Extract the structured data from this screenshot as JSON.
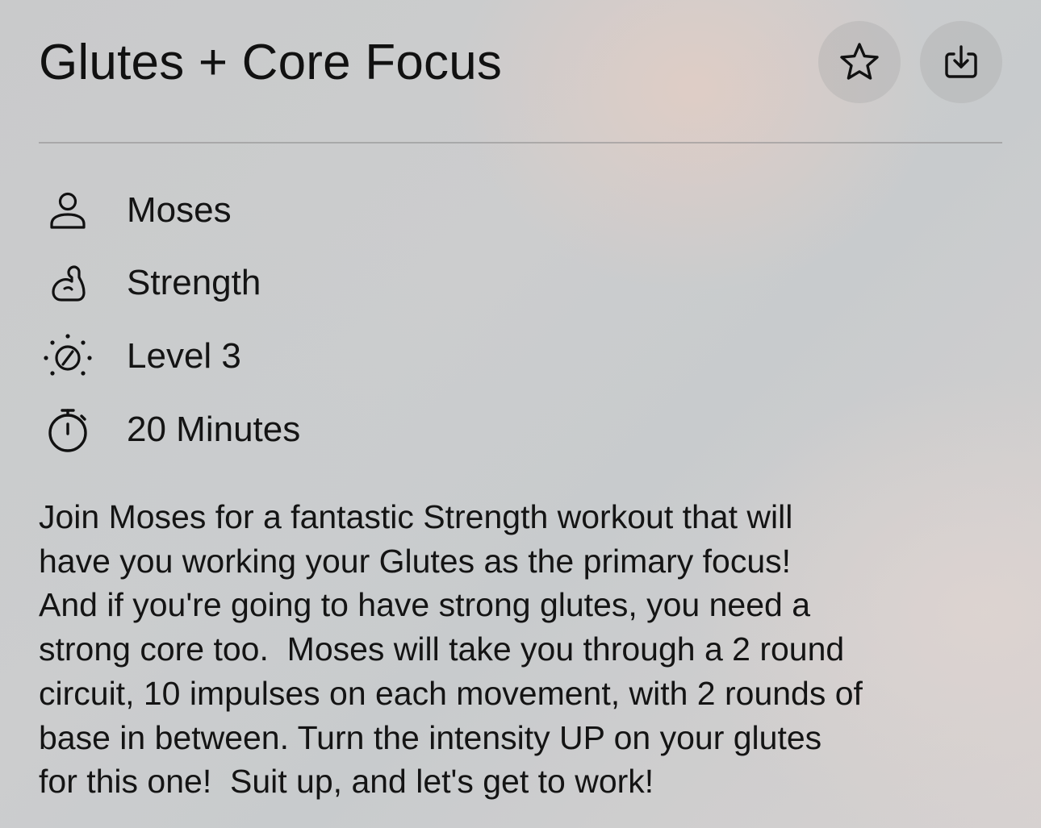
{
  "header": {
    "title": "Glutes + Core Focus",
    "favorite_icon": "star-outline-icon",
    "download_icon": "download-tray-icon"
  },
  "meta": {
    "instructor": {
      "icon": "person-icon",
      "label": "Moses"
    },
    "category": {
      "icon": "flexed-bicep-icon",
      "label": "Strength"
    },
    "level": {
      "icon": "intensity-gauge-icon",
      "label": "Level 3"
    },
    "duration": {
      "icon": "stopwatch-icon",
      "label": "20 Minutes"
    }
  },
  "description": {
    "lines": [
      "Join Moses for a fantastic Strength workout that will",
      "have you working your Glutes as the primary focus!",
      "And if you're going to have strong glutes, you need a",
      "strong core too.  Moses will take you through a 2 round",
      "circuit, 10 impulses on each movement, with 2 rounds of",
      "base in between. Turn the intensity UP on your glutes",
      "for this one!  Suit up, and let's get to work!"
    ]
  }
}
